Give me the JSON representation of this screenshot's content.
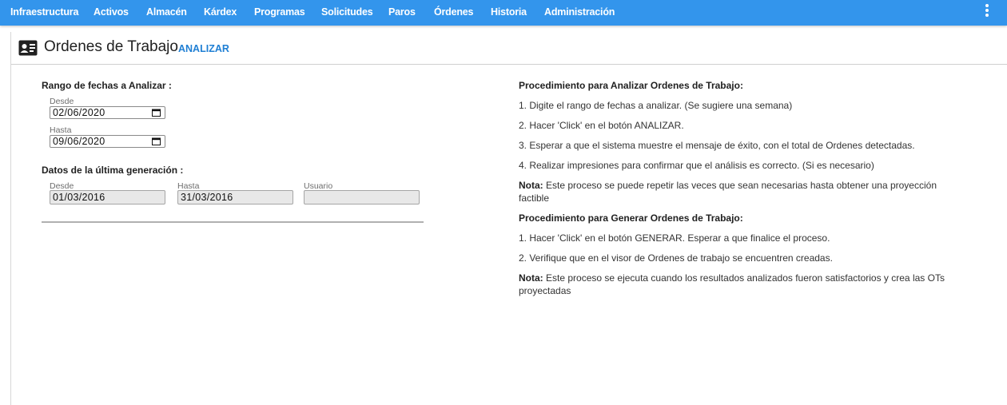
{
  "nav": {
    "items": [
      "Infraestructura",
      "Activos",
      "Almacén",
      "Kárdex",
      "Programas",
      "Solicitudes",
      "Paros",
      "Órdenes",
      "Historia",
      "Administración"
    ],
    "more_icon": "kebab-menu-icon"
  },
  "header": {
    "icon": "id-card-icon",
    "title": "Ordenes de Trabajo",
    "analizar_label": "ANALIZAR"
  },
  "range": {
    "title": "Rango de fechas a Analizar :",
    "desde_label": "Desde",
    "desde_value": "02/06/2020",
    "hasta_label": "Hasta",
    "hasta_value": "09/06/2020"
  },
  "last_gen": {
    "title": "Datos de la última generación :",
    "desde_label": "Desde",
    "desde_value": "01/03/2016",
    "hasta_label": "Hasta",
    "hasta_value": "31/03/2016",
    "usuario_label": "Usuario",
    "usuario_value": ""
  },
  "analyze_proc": {
    "title": "Procedimiento para Analizar Ordenes de Trabajo:",
    "steps": [
      "1. Digite el rango de fechas a analizar. (Se sugiere una semana)",
      "2. Hacer 'Click' en el botón ANALIZAR.",
      "3. Esperar a que el sistema muestre el mensaje de éxito, con el total de Ordenes detectadas.",
      "4. Realizar impresiones para confirmar que el análisis es correcto. (Si es necesario)"
    ],
    "note_label": "Nota:",
    "note_text": "Este proceso se puede repetir las veces que sean necesarias hasta obtener una proyección factible"
  },
  "generate_proc": {
    "title": "Procedimiento para Generar Ordenes de Trabajo:",
    "steps": [
      "1. Hacer 'Click' en el botón GENERAR. Esperar a que finalice el proceso.",
      "2. Verifique que en el visor de Ordenes de trabajo se encuentren creadas."
    ],
    "note_label": "Nota:",
    "note_text": "Este proceso se ejecuta cuando los resultados analizados fueron satisfactorios y crea las OTs proyectadas"
  }
}
